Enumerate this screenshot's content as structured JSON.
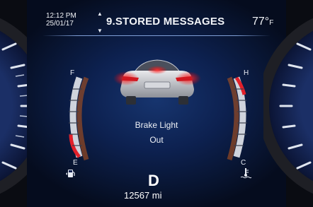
{
  "header": {
    "time": "12:12 PM",
    "date": "25/01/17",
    "title": "9.STORED MESSAGES",
    "temperature": "77°",
    "temperature_unit": "F"
  },
  "message": {
    "line1": "Brake Light",
    "line2": "Out"
  },
  "drive": {
    "gear": "D",
    "odometer": "12567 mi"
  },
  "fuel_gauge": {
    "full_label": "F",
    "empty_label": "E",
    "icon": "fuel-pump-icon"
  },
  "temp_gauge": {
    "hot_label": "H",
    "cold_label": "C",
    "icon": "coolant-temperature-icon"
  },
  "colors": {
    "accent_red": "#e2202a",
    "background_blue": "#0d2150",
    "warning_orange": "#d06a10"
  }
}
